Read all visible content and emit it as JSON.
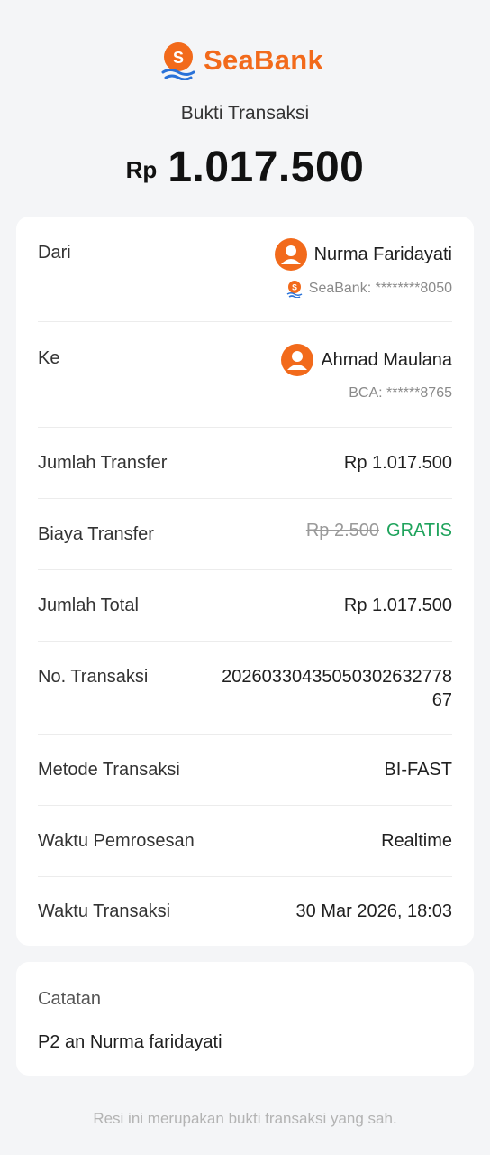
{
  "brand": {
    "name": "SeaBank",
    "accent_color": "#f26a1b",
    "logo_icon": "seabank-logo-icon"
  },
  "header": {
    "title": "Bukti Transaksi",
    "currency": "Rp",
    "amount": "1.017.500"
  },
  "details": {
    "from": {
      "label": "Dari",
      "name": "Nurma Faridayati",
      "account": "SeaBank: ********8050",
      "avatar_icon": "user-avatar-icon"
    },
    "to": {
      "label": "Ke",
      "name": "Ahmad Maulana",
      "account": "BCA: ******8765",
      "avatar_icon": "user-avatar-icon"
    },
    "transfer_amount": {
      "label": "Jumlah Transfer",
      "value": "Rp 1.017.500"
    },
    "transfer_fee": {
      "label": "Biaya Transfer",
      "original": "Rp 2.500",
      "value": "GRATIS",
      "value_color": "#1fa35c"
    },
    "total": {
      "label": "Jumlah Total",
      "value": "Rp 1.017.500"
    },
    "transaction_no": {
      "label": "No. Transaksi",
      "value": "20260330435050302632778 67"
    },
    "method": {
      "label": "Metode Transaksi",
      "value": "BI-FAST"
    },
    "processing_time": {
      "label": "Waktu Pemrosesan",
      "value": "Realtime"
    },
    "transaction_time": {
      "label": "Waktu Transaksi",
      "value": "30 Mar 2026, 18:03"
    }
  },
  "note": {
    "label": "Catatan",
    "value": "P2 an Nurma faridayati"
  },
  "footer": {
    "text": "Resi ini merupakan bukti transaksi yang sah."
  }
}
